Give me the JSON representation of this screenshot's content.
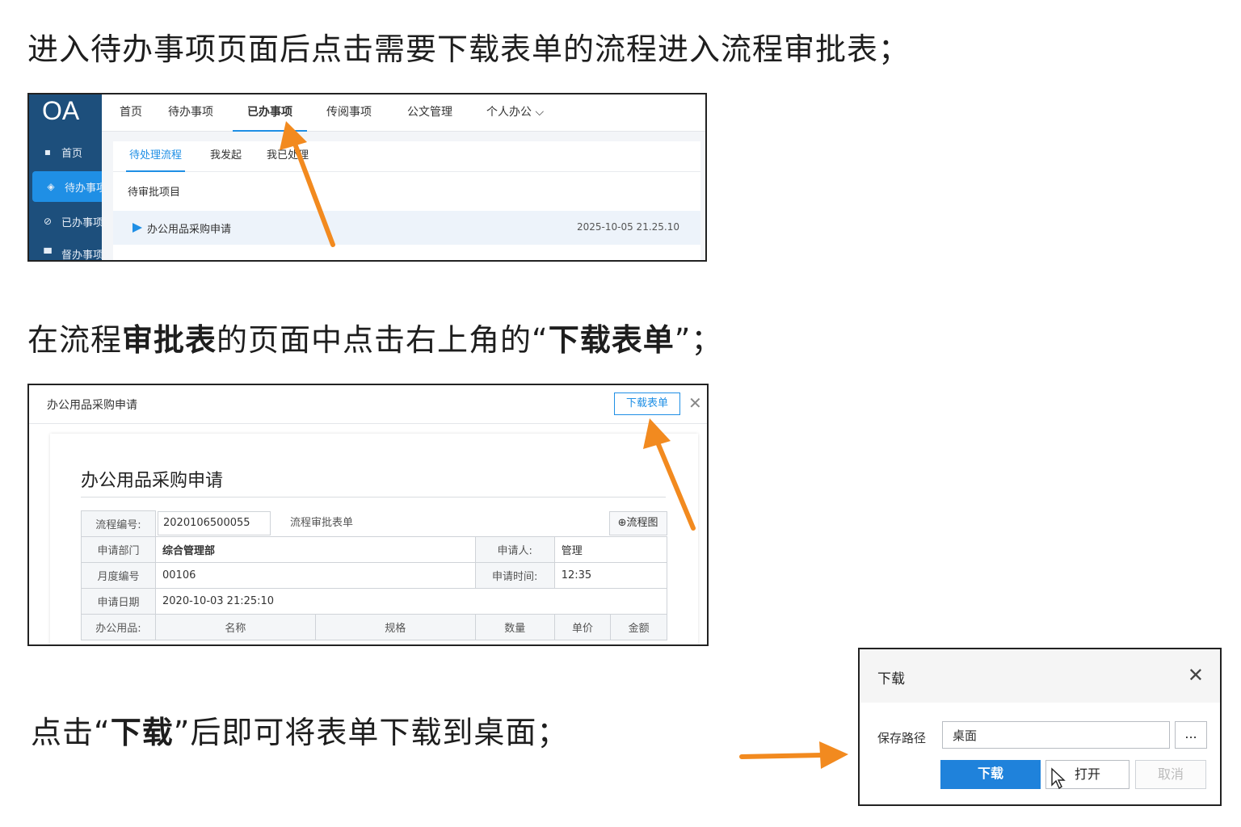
{
  "instructions": {
    "step1": "进入待办事项页面后点击需要下载表单的流程进入流程审批表；",
    "step2_prefix": "在流程",
    "step2_bold1": "审批表",
    "step2_mid": "的页面中点击右上角的“",
    "step2_bold2": "下载表单",
    "step2_suffix": "”；",
    "step3_prefix": "点击“",
    "step3_bold": "下载",
    "step3_suffix": "”后即可将表单下载到桌面；"
  },
  "oa": {
    "logo": "OA",
    "sidebar": [
      {
        "label": "首页",
        "icon": "home-icon",
        "glyph": "▪"
      },
      {
        "label": "待办事项",
        "icon": "pending-icon",
        "glyph": "◈"
      },
      {
        "label": "已办事项",
        "icon": "done-icon",
        "glyph": "⊘"
      },
      {
        "label": "督办事项",
        "icon": "supervise-icon",
        "glyph": "▀"
      }
    ],
    "topnav": [
      "首页",
      "待办事项",
      "已办事项",
      "传阅事项",
      "公文管理",
      "个人办公 ⌵"
    ],
    "subtabs": [
      "待处理流程",
      "我发起",
      "我已处理"
    ],
    "section_title": "待审批项目",
    "row": {
      "title": "办公用品采购申请",
      "time": "2025-10-05 21.25.10"
    }
  },
  "form": {
    "header_title": "办公用品采购申请",
    "download_label": "下载表单",
    "close_glyph": "✕",
    "title": "办公用品采购申请",
    "serial_label": "流程编号:",
    "serial_value": "2020106500055",
    "urgency_text": "流程审批表单",
    "view_button": "⊕流程图",
    "rows": [
      {
        "label": "申请部门",
        "value": "综合管理部",
        "label2": "申请人:",
        "value2": "管理"
      },
      {
        "label": "月度编号",
        "value": "00106",
        "label2": "申请时间:",
        "value2": "12:35"
      },
      {
        "label": "申请日期",
        "value": "2020-10-03 21:25:10"
      }
    ],
    "detail_label": "办公用品:",
    "detail_columns": [
      "名称",
      "规格",
      "数量",
      "单价",
      "金额"
    ]
  },
  "dialog": {
    "title": "下载",
    "close_glyph": "✕",
    "label": "保存路径",
    "input_value": "桌面",
    "browse": "...",
    "download": "下载",
    "open": "打开",
    "cancel": "取消"
  },
  "colors": {
    "accent": "#1f8fe5",
    "sidebar": "#1d4f7c",
    "arrow": "#f28a1f"
  }
}
